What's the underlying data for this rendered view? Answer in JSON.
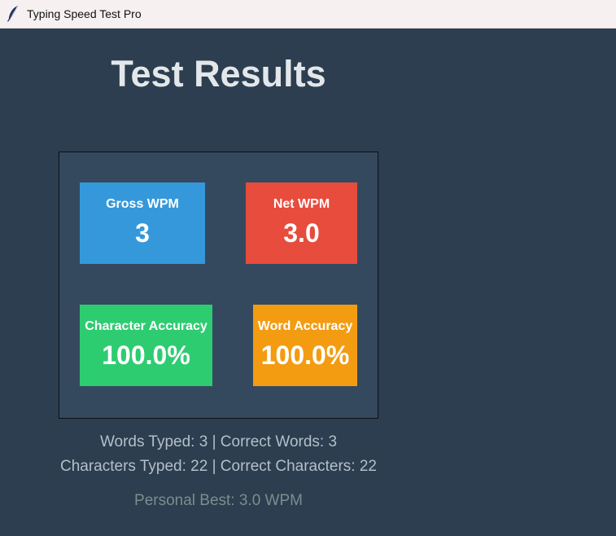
{
  "window": {
    "title": "Typing Speed Test Pro",
    "icon": "feather-icon"
  },
  "results": {
    "title": "Test Results",
    "cards": {
      "gross_wpm": {
        "label": "Gross WPM",
        "value": "3",
        "color": "#3498db"
      },
      "net_wpm": {
        "label": "Net WPM",
        "value": "3.0",
        "color": "#e74c3c"
      },
      "character_accuracy": {
        "label": "Character Accuracy",
        "value": "100.0%",
        "color": "#2ecc71"
      },
      "word_accuracy": {
        "label": "Word Accuracy",
        "value": "100.0%",
        "color": "#f39c12"
      }
    },
    "summary": {
      "words_line": "Words Typed: 3 | Correct Words: 3",
      "chars_line": "Characters Typed: 22 | Correct Characters: 22",
      "personal_best": "Personal Best: 3.0 WPM"
    }
  },
  "colors": {
    "background": "#2c3e50",
    "panel": "#34495e",
    "title_text": "#e4e7ea",
    "summary_text": "#b5bfc8",
    "personal_best_text": "#7f8c8d"
  }
}
